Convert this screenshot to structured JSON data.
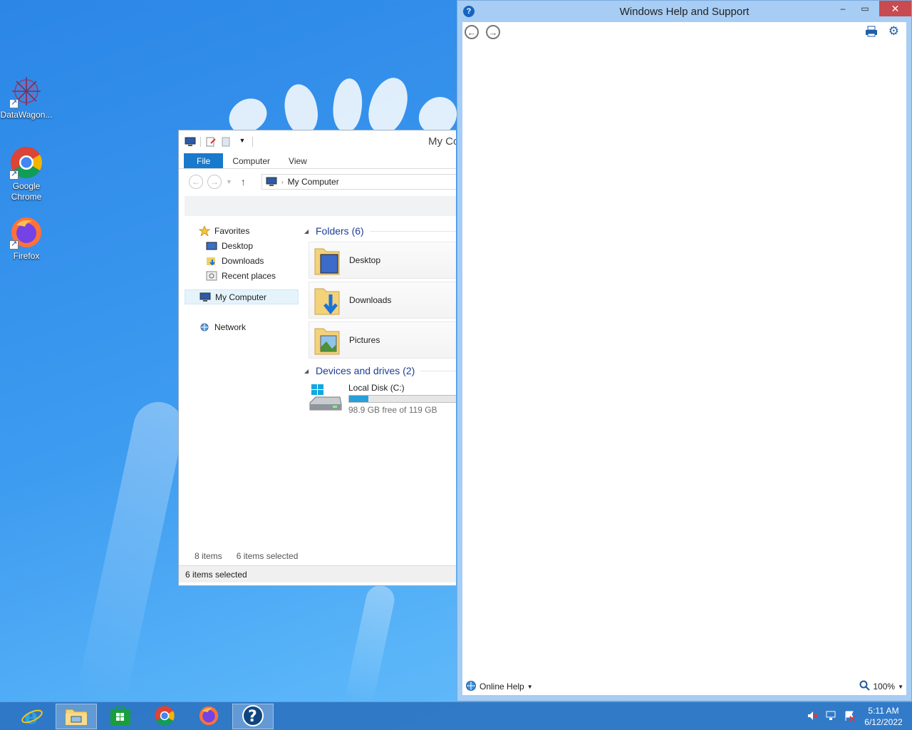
{
  "desktop": {
    "icons": [
      {
        "label": "DataWagon..."
      },
      {
        "label": "Google Chrome"
      },
      {
        "label": "Firefox"
      }
    ]
  },
  "explorer": {
    "title": "My Computer",
    "tabs": [
      "File",
      "Computer",
      "View"
    ],
    "address": "My Computer",
    "nav": {
      "favorites": "Favorites",
      "desktop": "Desktop",
      "downloads": "Downloads",
      "recent": "Recent places",
      "my_computer": "My Computer",
      "network": "Network"
    },
    "folders_header": "Folders (6)",
    "folders": [
      "Desktop",
      "Downloads",
      "Pictures"
    ],
    "devices_header": "Devices and drives (2)",
    "drive": {
      "name": "Local Disk (C:)",
      "free_text": "98.9 GB free of 119 GB",
      "used_fraction": 0.17
    },
    "status_items": "8 items",
    "status_selected": "6 items selected",
    "status_bar": "6 items selected"
  },
  "help": {
    "title": "Windows Help and Support",
    "footer_label": "Online Help",
    "zoom": "100%"
  },
  "taskbar": {
    "time": "5:11 AM",
    "date": "6/12/2022"
  },
  "colors": {
    "accent": "#1979ca",
    "close": "#c74b50",
    "drive_fill": "#26a0da"
  }
}
